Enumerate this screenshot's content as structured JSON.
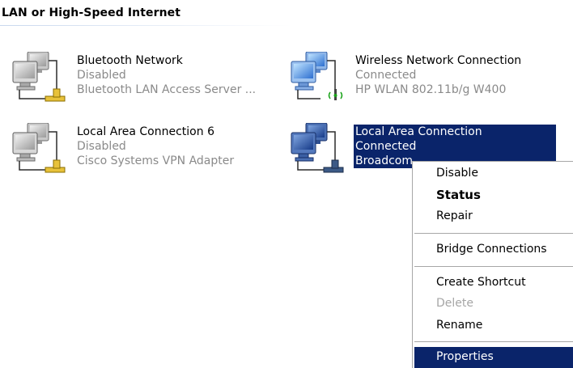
{
  "section": {
    "title": "LAN or High-Speed Internet"
  },
  "connections": [
    {
      "name": "Bluetooth Network",
      "status": "Disabled",
      "device": "Bluetooth LAN Access Server ...",
      "icon": "network-disabled-icon"
    },
    {
      "name": "Wireless Network Connection",
      "status": "Connected",
      "device": "HP WLAN 802.11b/g W400",
      "icon": "wireless-connected-icon"
    },
    {
      "name": "Local Area Connection 6",
      "status": "Disabled",
      "device": "Cisco Systems VPN Adapter",
      "icon": "network-disabled-icon"
    },
    {
      "name": "Local Area Connection",
      "status": "Connected",
      "device": "Broadcom",
      "icon": "network-connected-icon"
    }
  ],
  "context_menu": {
    "items": [
      {
        "label": "Disable"
      },
      {
        "label": "Status"
      },
      {
        "label": "Repair"
      },
      {
        "label": "Bridge Connections"
      },
      {
        "label": "Create Shortcut"
      },
      {
        "label": "Delete"
      },
      {
        "label": "Rename"
      },
      {
        "label": "Properties"
      }
    ]
  },
  "colors": {
    "selection": "#0a246a",
    "disabled_text": "#8a8a8a",
    "accent_yellow": "#e8c23a",
    "monitor_blue": "#3b72c8"
  }
}
